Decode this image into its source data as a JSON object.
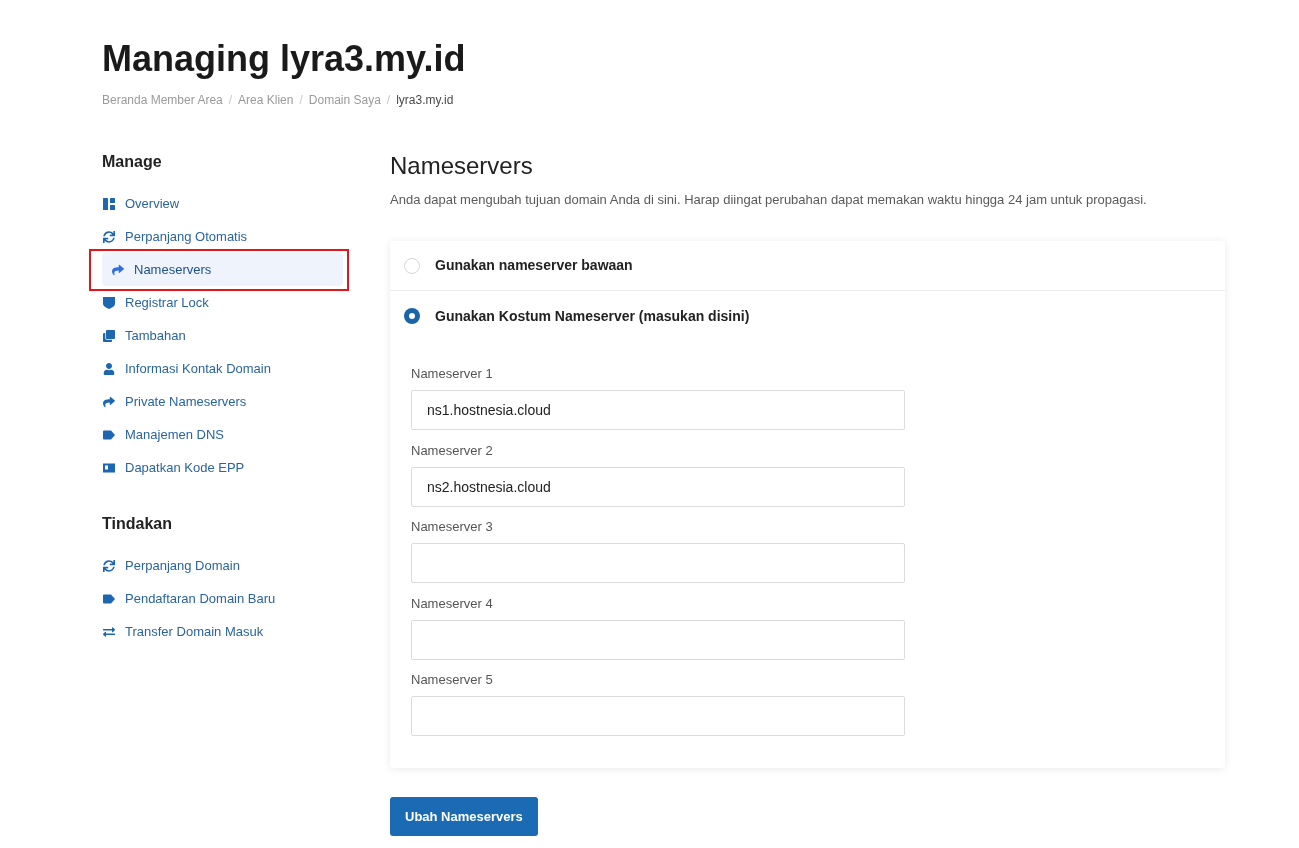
{
  "page_title": "Managing lyra3.my.id",
  "breadcrumb": [
    {
      "label": "Beranda Member Area",
      "current": false
    },
    {
      "separator": "/",
      "label": "Area Klien",
      "current": false
    },
    {
      "separator": "/",
      "label": "Domain Saya",
      "current": false
    },
    {
      "separator": "/",
      "label": "lyra3.my.id",
      "current": true
    }
  ],
  "sidebar": {
    "sections": [
      {
        "heading": "Manage",
        "items": [
          {
            "label": "Overview",
            "selected": false,
            "highlighted": false
          },
          {
            "label": "Perpanjang Otomatis",
            "selected": false,
            "highlighted": false
          },
          {
            "label": "Nameservers",
            "selected": true,
            "highlighted": true
          },
          {
            "label": "Registrar Lock",
            "selected": false,
            "highlighted": false
          },
          {
            "label": "Tambahan",
            "selected": false,
            "highlighted": false
          },
          {
            "label": "Informasi Kontak Domain",
            "selected": false,
            "highlighted": false
          },
          {
            "label": "Private Nameservers",
            "selected": false,
            "highlighted": false
          },
          {
            "label": "Manajemen DNS",
            "selected": false,
            "highlighted": false
          },
          {
            "label": "Dapatkan Kode EPP",
            "selected": false,
            "highlighted": false
          }
        ]
      },
      {
        "heading": "Tindakan",
        "items": [
          {
            "label": "Perpanjang Domain",
            "selected": false,
            "highlighted": false
          },
          {
            "label": "Pendaftaran Domain Baru",
            "selected": false,
            "highlighted": false
          },
          {
            "label": "Transfer Domain Masuk",
            "selected": false,
            "highlighted": false
          }
        ]
      }
    ]
  },
  "main": {
    "heading": "Nameservers",
    "description": "Anda dapat mengubah tujuan domain Anda di sini. Harap diingat perubahan dapat memakan waktu hingga 24 jam untuk propagasi.",
    "options": [
      {
        "label": "Gunakan nameserver bawaan",
        "selected": false
      },
      {
        "label": "Gunakan Kostum Nameserver (masukan disini)",
        "selected": true
      }
    ],
    "fields": [
      {
        "label": "Nameserver 1",
        "value": "ns1.hostnesia.cloud"
      },
      {
        "label": "Nameserver 2",
        "value": "ns2.hostnesia.cloud"
      },
      {
        "label": "Nameserver 3"
      },
      {
        "label": "Nameserver 4"
      },
      {
        "label": "Nameserver 5"
      }
    ],
    "submit_button": "Ubah Nameservers"
  }
}
